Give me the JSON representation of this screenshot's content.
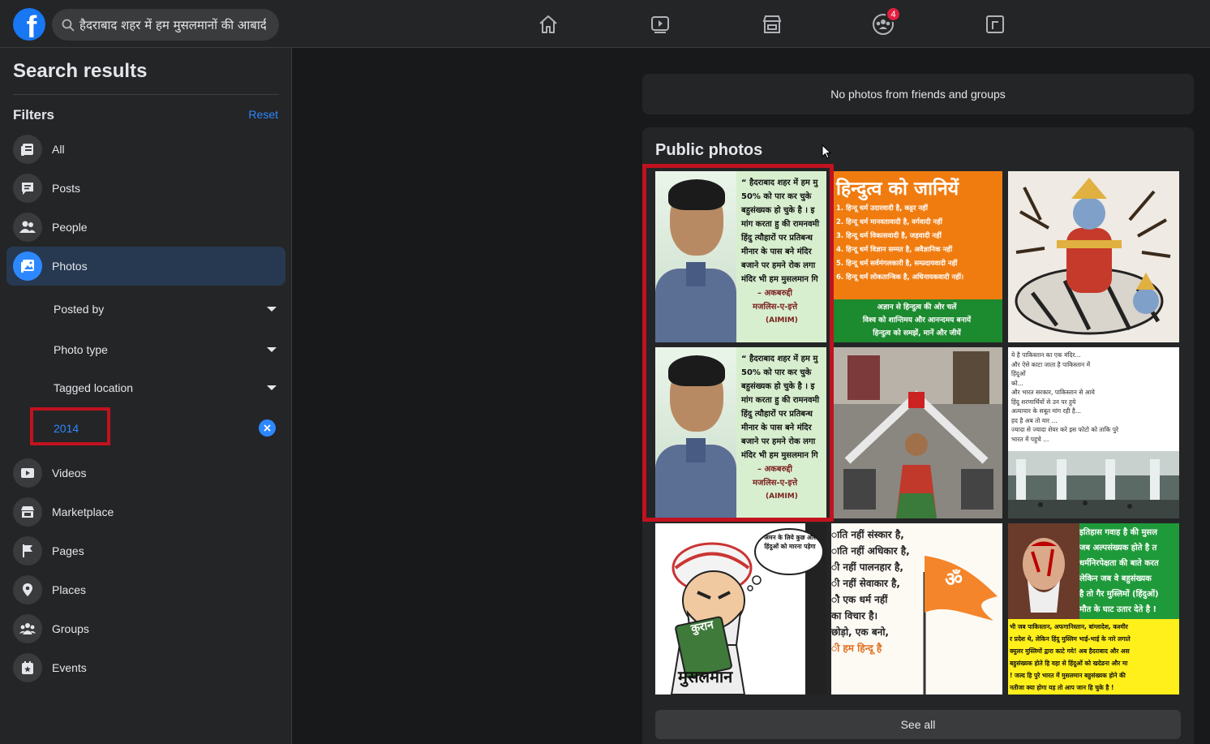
{
  "topbar": {
    "search_value": "हैदराबाद शहर में हम मुसलमानों की आबादी",
    "notifications_badge": "4"
  },
  "sidebar": {
    "title": "Search results",
    "filters_label": "Filters",
    "reset_label": "Reset",
    "items": [
      {
        "label": "All",
        "icon": "all-icon"
      },
      {
        "label": "Posts",
        "icon": "posts-icon"
      },
      {
        "label": "People",
        "icon": "people-icon"
      },
      {
        "label": "Photos",
        "icon": "photos-icon"
      },
      {
        "label": "Videos",
        "icon": "videos-icon"
      },
      {
        "label": "Marketplace",
        "icon": "marketplace-icon"
      },
      {
        "label": "Pages",
        "icon": "pages-icon"
      },
      {
        "label": "Places",
        "icon": "places-icon"
      },
      {
        "label": "Groups",
        "icon": "groups-icon"
      },
      {
        "label": "Events",
        "icon": "events-icon"
      }
    ],
    "photo_filters": {
      "posted_by": "Posted by",
      "photo_type": "Photo type",
      "tagged_location": "Tagged location",
      "year": "2014"
    }
  },
  "main": {
    "no_photos_text": "No photos from friends and groups",
    "public_photos_title": "Public photos",
    "see_all_label": "See all",
    "photos": [
      {
        "lines": [
          "“ हैदराबाद शहर में हम मु",
          "50% को पार कर चुके",
          "बहुसंख्यक हो चुके है । इ",
          "मांग करता हु की रामनवमी",
          "हिंदु त्यौहारों पर प्रतिबन्ध",
          "मीनार के पास बने मंदिर",
          "बजाने पर हमने रोक लगा",
          "मंदिर भी हम मुसलमान गि",
          "– अकबरुद्दी",
          "मजलिस-ए-इत्ते",
          "(AIMIM)"
        ]
      },
      {
        "title": "हिन्दुत्व को जानियें",
        "lines": [
          "1. हिन्दू धर्म उदारवादी है, कट्टर नहीं",
          "2. हिन्दू धर्म मानवतावादी है, वर्गवादी नहीं",
          "3. हिन्दू धर्म विकासवादी है, जड़वादी नहीं",
          "4. हिन्दू धर्म विज्ञान सम्मत है, अवैज्ञानिक नहीं",
          "5. हिन्दू धर्म सर्वमंगलकारी है, सम्प्रदायवादी नहीं",
          "6. हिन्दू धर्म लोकतान्त्रिक है, अधिनायकवादी नहीं।"
        ],
        "footer": [
          "अज्ञान से हिन्दुत्व की ओर चलें",
          "विश्व को शान्तिमय और आनन्दमय बनायें",
          "हिन्दुत्व को समझें, मानें और जीयें"
        ]
      },
      {},
      {
        "lines": [
          "“ हैदराबाद शहर में हम मु",
          "50% को पार कर चुके",
          "बहुसंख्यक हो चुके है । इ",
          "मांग करता हु की रामनवमी",
          "हिंदु त्यौहारों पर प्रतिबन्ध",
          "मीनार के पास बने मंदिर",
          "बजाने पर हमने रोक लगा",
          "मंदिर भी हम मुसलमान गि",
          "– अकबरुद्दी",
          "मजलिस-ए-इत्ते",
          "(AIMIM)"
        ]
      },
      {},
      {
        "lines": [
          "ये है पाकिस्तान का एक मंदिर...",
          "और ऐसे काटा जाता है पाकिस्तान में",
          "हिंदुओं",
          "को...",
          "और भारत सरकार, पाकिस्तान से आये",
          "हिंदु शरणार्थियों से उन पर हुये",
          "अत्याचार के सबूत मांग रही है...",
          "हद है अब तो यार ...",
          "ज्यादा से ज्यादा शेयर करे इस फोटो को ताकि पुरे",
          "भारत में पहुचे ..."
        ]
      },
      {
        "bubble": "अमन के लिये कुछ और हिंदुओं को मारना पड़ेगा",
        "book": "कुरान",
        "caption": "मुसलमान"
      },
      {
        "lines": [
          "ाति नहीं संस्कार है,",
          "ाति नहीं अधिकार है,",
          "ी नहीं पालनहार है,",
          "ी नहीं सेवाकार है,",
          "",
          "ौ एक धर्म नहीं",
          "का विचार है।",
          "",
          "छोड़ो, एक बनो,",
          "ी हम हिन्दू है"
        ],
        "flag_symbol": "ॐ"
      },
      {
        "lines": [
          "इतिहास गवाह है की मुसल",
          "जब अल्पसंख्यक होते है त",
          "धर्मनिरपेक्षता की बाते करत",
          "लेकिन जब वे बहुसंख्यक",
          "है तो गैर मुस्लिमों (हिंदुओं)",
          "मौत के घाट उतार देते है !"
        ],
        "footer": [
          "भी जब पाकिस्तान, अफगानिस्तान, बांग्लादेश, कश्मीर",
          "र प्रदेश थे, लेकिन हिंदु मुस्लिम भाई-भाई के नारे लगाते",
          "क्युलर मुस्लिमों द्वारा काटे गये! अब हैदराबाद और अस",
          "बहुसंख्यक होते हि वहा से हिंदुओं को खदेडना और मा",
          "! जल्द हि पुरे भारत में मुसलमान बहुसंख्यक होने की",
          "नतीजा क्या होगा यह तो आप जान हि चुके है !"
        ]
      }
    ]
  },
  "colors": {
    "accent": "#2d88ff",
    "highlight": "#c1121f",
    "badge": "#e41e3f"
  }
}
